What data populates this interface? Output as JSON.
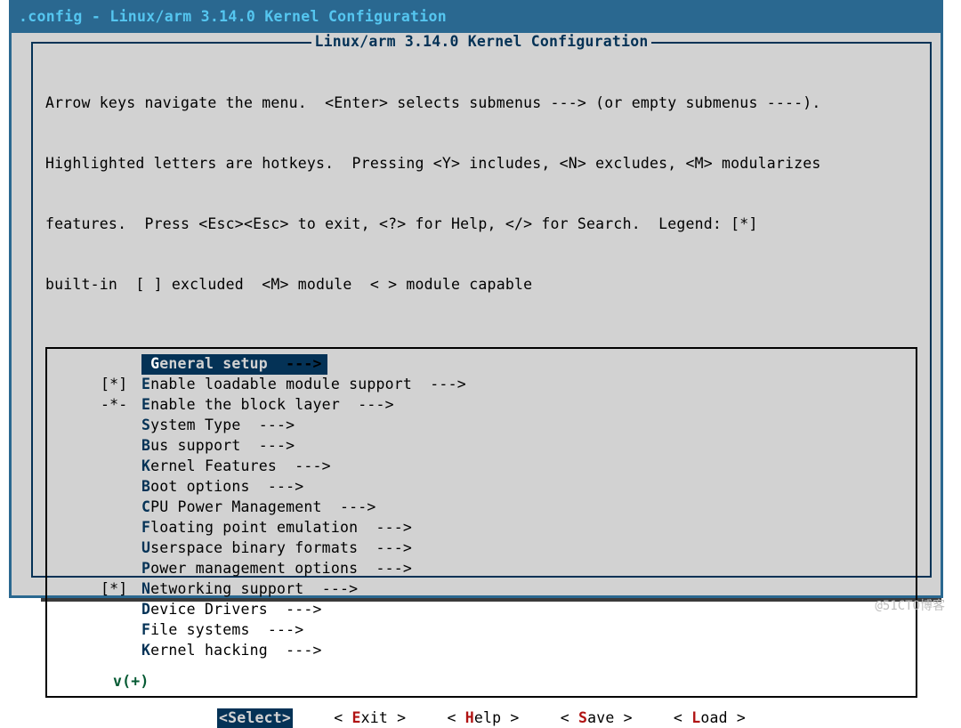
{
  "window": {
    "title": ".config - Linux/arm 3.14.0 Kernel Configuration"
  },
  "dialog": {
    "title": " Linux/arm 3.14.0 Kernel Configuration ",
    "help_line1": "Arrow keys navigate the menu.  <Enter> selects submenus ---> (or empty submenus ----).",
    "help_line2": "Highlighted letters are hotkeys.  Pressing <Y> includes, <N> excludes, <M> modularizes",
    "help_line3": "features.  Press <Esc><Esc> to exit, <?> for Help, </> for Search.  Legend: [*]",
    "help_line4": "built-in  [ ] excluded  <M> module  < > module capable",
    "more_indicator": "v(+)"
  },
  "menu": [
    {
      "mark": "   ",
      "hot": "G",
      "rest": "eneral setup",
      "arrow": "  --->",
      "selected": true
    },
    {
      "mark": "[*]",
      "hot": "E",
      "rest": "nable loadable module support",
      "arrow": "  --->",
      "selected": false
    },
    {
      "mark": "-*-",
      "hot": "E",
      "rest": "nable the block layer",
      "arrow": "  --->",
      "selected": false
    },
    {
      "mark": "   ",
      "hot": "S",
      "rest": "ystem Type",
      "arrow": "  --->",
      "selected": false
    },
    {
      "mark": "   ",
      "hot": "B",
      "rest": "us support",
      "arrow": "  --->",
      "selected": false
    },
    {
      "mark": "   ",
      "hot": "K",
      "rest": "ernel Features",
      "arrow": "  --->",
      "selected": false
    },
    {
      "mark": "   ",
      "hot": "B",
      "rest": "oot options",
      "arrow": "  --->",
      "selected": false
    },
    {
      "mark": "   ",
      "hot": "C",
      "rest": "PU Power Management",
      "arrow": "  --->",
      "selected": false
    },
    {
      "mark": "   ",
      "hot": "F",
      "rest": "loating point emulation",
      "arrow": "  --->",
      "selected": false
    },
    {
      "mark": "   ",
      "hot": "U",
      "rest": "serspace binary formats",
      "arrow": "  --->",
      "selected": false
    },
    {
      "mark": "   ",
      "hot": "P",
      "rest": "ower management options",
      "arrow": "  --->",
      "selected": false
    },
    {
      "mark": "[*]",
      "hot": "N",
      "rest": "etworking support",
      "arrow": "  --->",
      "selected": false
    },
    {
      "mark": "   ",
      "hot": "D",
      "rest": "evice Drivers",
      "arrow": "  --->",
      "selected": false
    },
    {
      "mark": "   ",
      "hot": "F",
      "rest": "ile systems",
      "arrow": "  --->",
      "selected": false
    },
    {
      "mark": "   ",
      "hot": "K",
      "rest": "ernel hacking",
      "arrow": "  --->",
      "selected": false
    }
  ],
  "buttons": {
    "select": {
      "pre": "<",
      "hot": "S",
      "rest": "elect>",
      "active": true
    },
    "exit": {
      "pre": "< ",
      "hot": "E",
      "rest": "xit >",
      "active": false
    },
    "help": {
      "pre": "< ",
      "hot": "H",
      "rest": "elp >",
      "active": false
    },
    "save": {
      "pre": "< ",
      "hot": "S",
      "rest": "ave >",
      "active": false
    },
    "load": {
      "pre": "< ",
      "hot": "L",
      "rest": "oad >",
      "active": false
    }
  },
  "watermark": "@51CTO博客"
}
